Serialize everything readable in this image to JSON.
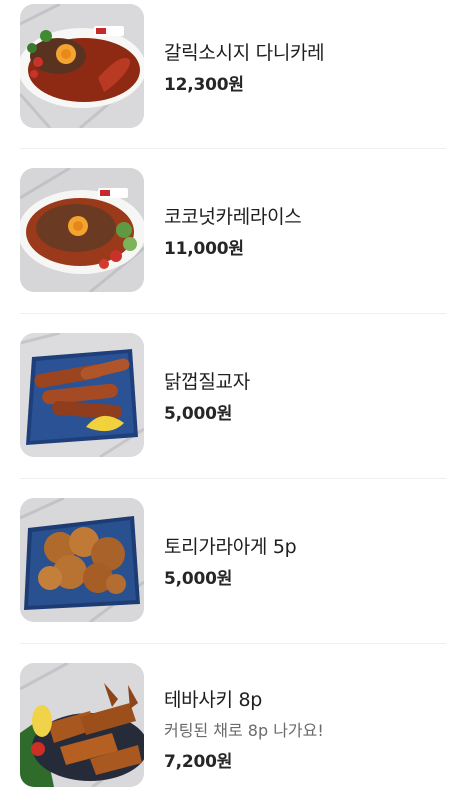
{
  "menu": {
    "items": [
      {
        "name": "갈릭소시지 다니카레",
        "description": "",
        "price": "12,300원",
        "image": "garlic-sausage-curry-photo"
      },
      {
        "name": "코코넛카레라이스",
        "description": "",
        "price": "11,000원",
        "image": "coconut-curry-rice-photo"
      },
      {
        "name": "닭껍질교자",
        "description": "",
        "price": "5,000원",
        "image": "chicken-skin-gyoza-photo"
      },
      {
        "name": "토리가라아게 5p",
        "description": "",
        "price": "5,000원",
        "image": "tori-karaage-photo"
      },
      {
        "name": "테바사키 8p",
        "description": "커팅된 채로 8p 나가요!",
        "price": "7,200원",
        "image": "tebasaki-wings-photo"
      }
    ]
  },
  "colors": {
    "text_primary": "#1f1f1f",
    "text_secondary": "#6b6b6b",
    "divider": "#efefef",
    "background": "#ffffff"
  }
}
